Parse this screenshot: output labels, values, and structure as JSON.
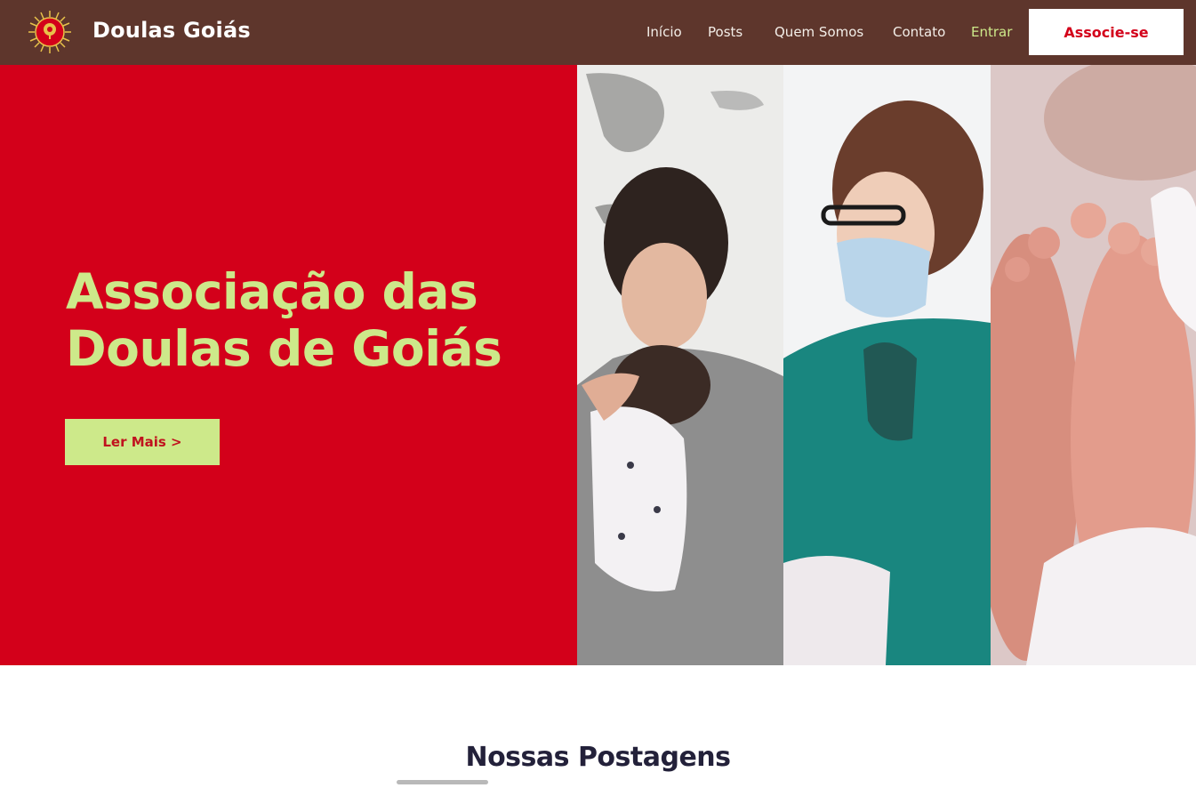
{
  "header": {
    "brand": "Doulas Goiás",
    "nav": [
      {
        "label": "Início"
      },
      {
        "label": "Posts"
      },
      {
        "label": "Quem Somos"
      },
      {
        "label": "Contato"
      },
      {
        "label": "Entrar"
      }
    ],
    "cta_label": "Associe-se",
    "logo_icon": "sun-tree-logo-icon"
  },
  "hero": {
    "title_line1": "Associação das",
    "title_line2": "Doulas de Goiás",
    "button_label": "Ler Mais >",
    "images": [
      "mother-holding-newborn-photo",
      "nurse-in-scrubs-with-mask-photo",
      "baby-feet-photo"
    ]
  },
  "section": {
    "title": "Nossas Postagens"
  },
  "colors": {
    "header_bg": "#5e362c",
    "hero_red": "#d3001a",
    "accent_lime": "#cde98a",
    "heading_dark": "#23213a"
  }
}
